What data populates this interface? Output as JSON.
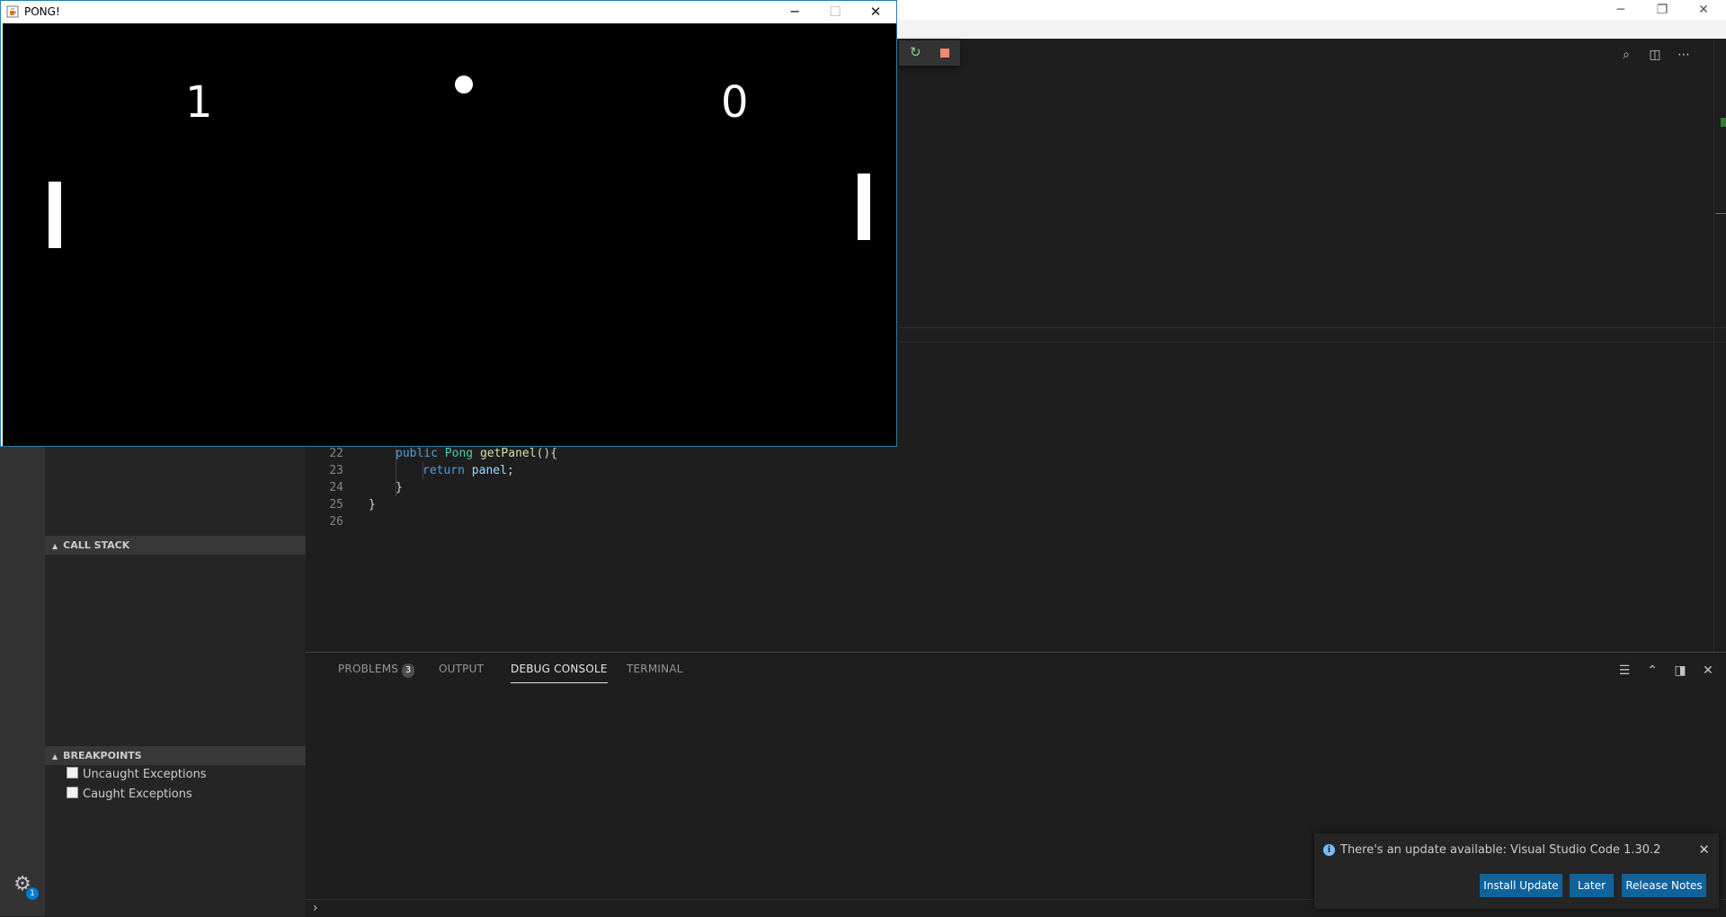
{
  "vscode": {
    "window_controls": {
      "minimize": "─",
      "restore": "❐",
      "close": "✕"
    },
    "sections": {
      "call_stack": "CALL STACK",
      "breakpoints": "BREAKPOINTS"
    },
    "breakpoints": [
      "Uncaught Exceptions",
      "Caught Exceptions"
    ],
    "editor": {
      "lines": [
        {
          "n": "22",
          "indent": 1,
          "tokens": [
            [
              "kw",
              "public"
            ],
            [
              "t",
              " "
            ],
            [
              "ty",
              "Pong"
            ],
            [
              "t",
              " "
            ],
            [
              "fn",
              "getPanel"
            ],
            [
              "t",
              "(){"
            ]
          ]
        },
        {
          "n": "23",
          "indent": 2,
          "tokens": [
            [
              "kw",
              "return"
            ],
            [
              "t",
              " "
            ],
            [
              "va",
              "panel"
            ],
            [
              "t",
              ";"
            ]
          ]
        },
        {
          "n": "24",
          "indent": 1,
          "tokens": [
            [
              "t",
              "}"
            ]
          ]
        },
        {
          "n": "25",
          "indent": 0,
          "tokens": [
            [
              "t",
              "}"
            ]
          ]
        },
        {
          "n": "26",
          "indent": 0,
          "tokens": []
        }
      ]
    },
    "panel": {
      "tabs": [
        {
          "label": "PROBLEMS",
          "badge": "3",
          "active": false
        },
        {
          "label": "OUTPUT",
          "active": false
        },
        {
          "label": "DEBUG CONSOLE",
          "active": true
        },
        {
          "label": "TERMINAL",
          "active": false
        }
      ],
      "repl_prompt": "›"
    },
    "settings_badge": "1",
    "notification": {
      "message": "There's an update available: Visual Studio Code 1.30.2",
      "buttons": {
        "install": "Install Update",
        "later": "Later",
        "release_notes": "Release Notes"
      },
      "close": "✕"
    }
  },
  "pong": {
    "title": "PONG!",
    "window_controls": {
      "minimize": "─",
      "maximize": "☐",
      "close": "✕"
    },
    "scores": {
      "left": "1",
      "right": "0"
    }
  }
}
